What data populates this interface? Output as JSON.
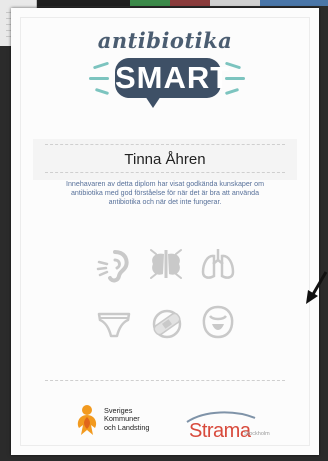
{
  "certificate": {
    "logo_top_text": "antibiotika",
    "logo_main_text": "SMART",
    "recipient_name": "Tinna Åhren",
    "description": "Innehavaren av detta diplom har visat godkända kunskaper om antibiotika med god förståelse för när det är bra att använda antibiotika och när det inte fungerar.",
    "icons": [
      "ear-icon",
      "sinus-icon",
      "lungs-icon",
      "underwear-icon",
      "bandage-icon",
      "throat-icon"
    ],
    "footer": {
      "org1_line1": "Sveriges",
      "org1_line2": "Kommuner",
      "org1_line3": "och Landsting",
      "org2_name": "Strama",
      "org2_sub": "Stockholm"
    }
  },
  "colors": {
    "logo_navy": "#3e5066",
    "logo_teal": "#7cc4bf",
    "description_text": "#58719a",
    "strama_red": "#d84a3c",
    "skl_orange": "#f29a1f",
    "icon_gray": "#c9c9c9"
  }
}
